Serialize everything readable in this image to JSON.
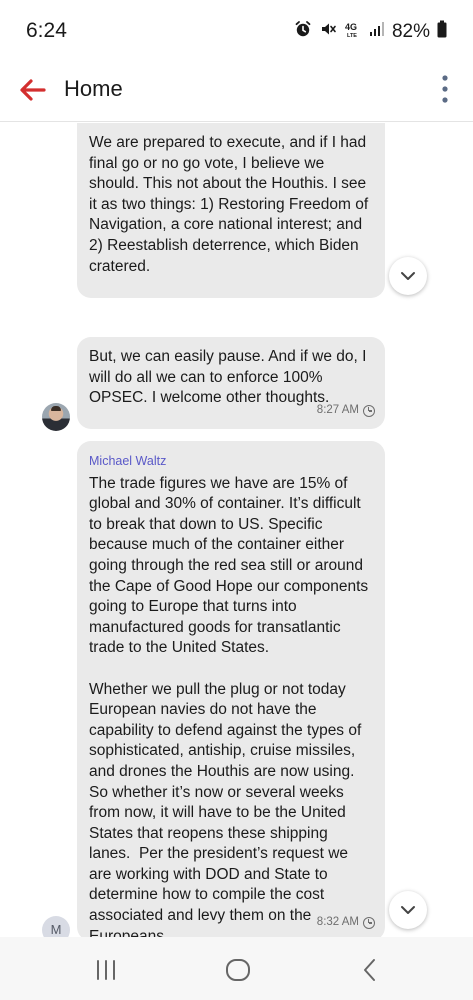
{
  "status_bar": {
    "time": "6:24",
    "battery": "82%",
    "icons": [
      "alarm-icon",
      "mute-icon",
      "4g-lte-icon",
      "signal-icon",
      "battery-icon"
    ]
  },
  "app_bar": {
    "title": "Home",
    "icons": [
      "back-arrow-icon",
      "more-vert-icon"
    ],
    "accent_color": "#d32f2f"
  },
  "messages": [
    {
      "text": "We are prepared to execute, and if I had final go or no go vote, I believe we should. This not about the Houthis. I see it as two things: 1) Restoring Freedom of Navigation, a core national interest; and 2) Reestablish deterrence, which Biden cratered."
    },
    {
      "text": "But, we can easily pause. And if we do, I will do all we can to enforce 100% OPSEC. I welcome other thoughts.",
      "time": "8:27 AM"
    },
    {
      "sender": "Michael Waltz",
      "avatar_initial": "M",
      "text": "The trade figures we have are 15% of global and 30% of container. It’s difficult to break that down to US. Specific because much of the container either going through the red sea still or around the Cape of Good Hope our components going to Europe that turns into manufactured goods for transatlantic trade to the United States.\n\nWhether we pull the plug or not today European navies do not have the capability to defend against the types of sophisticated, antiship, cruise missiles, and drones the Houthis are now using. So whether it’s now or several weeks from now, it will have to be the United States that reopens these shipping lanes.  Per the president’s request we are working with DOD and State to determine how to compile the cost associated and levy them on the Europeans.",
      "time": "8:32 AM"
    }
  ],
  "colors": {
    "bubble_bg": "#eaeaea",
    "sender_name": "#5a59c8",
    "timestamp": "#6e6e6e"
  },
  "nav_bar": {
    "buttons": [
      "recents-icon",
      "home-icon",
      "back-icon"
    ]
  }
}
